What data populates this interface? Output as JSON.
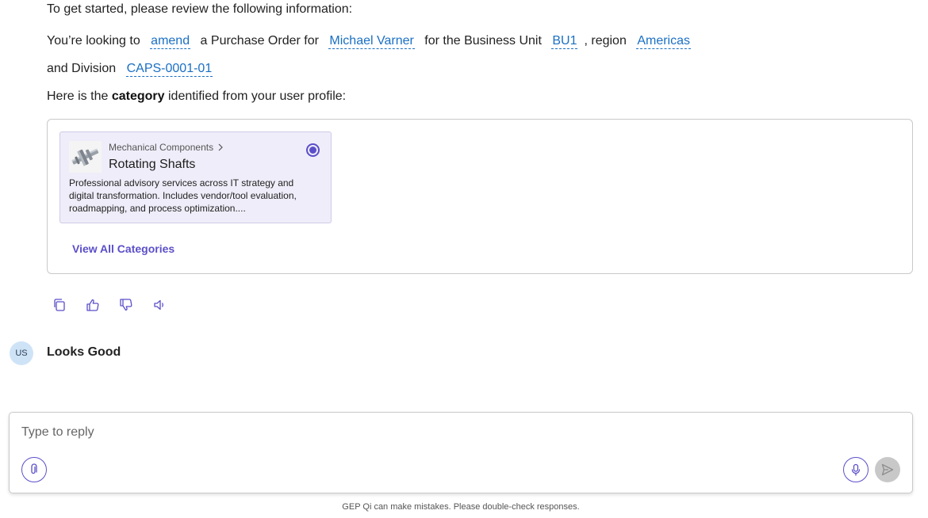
{
  "intro": {
    "line1": "To get started, please review the following information:",
    "p1": "You’re looking to",
    "action": "amend",
    "p2": "a Purchase Order for",
    "person": "Michael Varner",
    "p3": "for the Business Unit",
    "bu": "BU1",
    "p4": ", region",
    "region": "Americas",
    "p5": "and Division",
    "division": "CAPS-0001-01",
    "p6_pre": "Here is the",
    "p6_bold": "category",
    "p6_post": "identified from your user profile:"
  },
  "category": {
    "breadcrumb": "Mechanical Components",
    "title": "Rotating Shafts",
    "description": "Professional advisory services across IT strategy and digital transformation. Includes vendor/tool evaluation, roadmapping, and process optimization....",
    "view_all": "View All Categories"
  },
  "actions": [
    "copy-icon",
    "thumbs-up-icon",
    "thumbs-down-icon",
    "speaker-icon"
  ],
  "user": {
    "initials": "US",
    "message": "Looks Good"
  },
  "composer": {
    "placeholder": "Type to reply"
  },
  "disclaimer": "GEP Qi can make mistakes. Please double-check responses.",
  "colors": {
    "accent": "#5b4fc9",
    "link": "#1a6fc4",
    "card_bg": "#efedf9",
    "avatar_bg": "#cfe3f7"
  }
}
